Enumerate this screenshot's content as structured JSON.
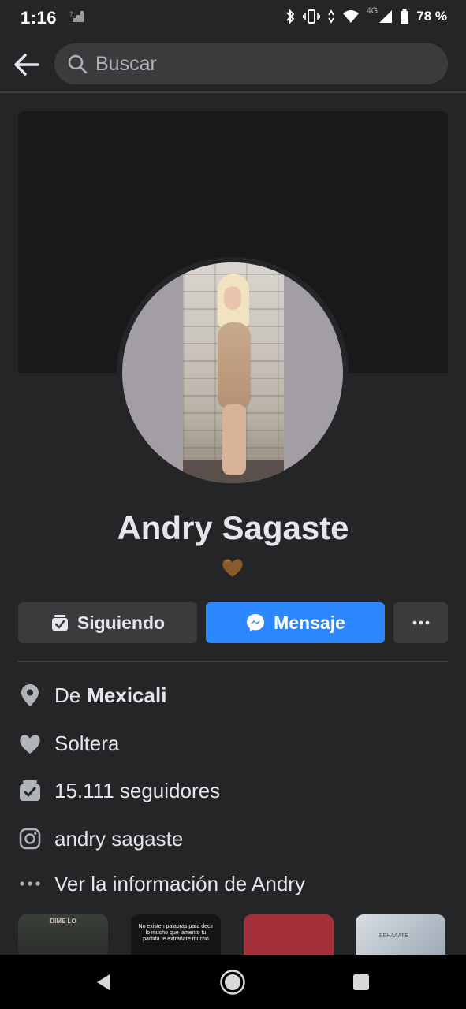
{
  "status_bar": {
    "time": "1:16",
    "network": "4G",
    "battery": "78 %"
  },
  "header": {
    "search_placeholder": "Buscar"
  },
  "profile": {
    "name": "Andry Sagaste",
    "bio_emoji": "brown-heart"
  },
  "actions": {
    "following_label": "Siguiendo",
    "message_label": "Mensaje",
    "more_label": "···"
  },
  "info": {
    "hometown_prefix": "De",
    "hometown": "Mexicali",
    "relationship": "Soltera",
    "followers": "15.111 seguidores",
    "instagram": "andry sagaste",
    "see_more": "Ver la información de Andry"
  },
  "featured": {
    "thumb1_text": "DIME LO",
    "thumb2_text": "No existen palabras para decir lo mucho que lamento tu partida te extrañare mucho",
    "thumb4_text": "EEHAAAFE"
  },
  "colors": {
    "background": "#242526",
    "accent": "#2d88ff",
    "button_dark": "#3a3b3c"
  }
}
